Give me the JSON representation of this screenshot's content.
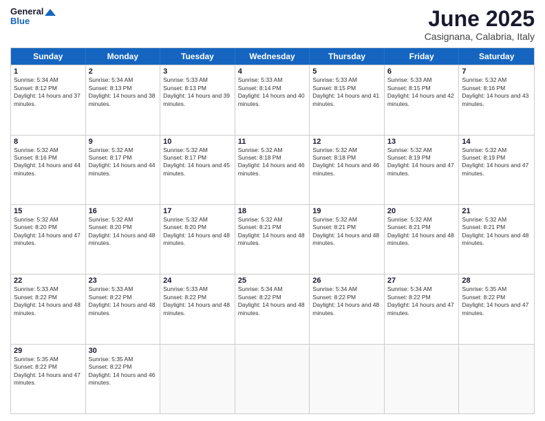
{
  "logo": {
    "line1": "General",
    "line2": "Blue"
  },
  "title": "June 2025",
  "subtitle": "Casignana, Calabria, Italy",
  "header_days": [
    "Sunday",
    "Monday",
    "Tuesday",
    "Wednesday",
    "Thursday",
    "Friday",
    "Saturday"
  ],
  "rows": [
    [
      {
        "day": "",
        "sunrise": "",
        "sunset": "",
        "daylight": ""
      },
      {
        "day": "2",
        "sunrise": "Sunrise: 5:34 AM",
        "sunset": "Sunset: 8:13 PM",
        "daylight": "Daylight: 14 hours and 38 minutes."
      },
      {
        "day": "3",
        "sunrise": "Sunrise: 5:33 AM",
        "sunset": "Sunset: 8:13 PM",
        "daylight": "Daylight: 14 hours and 39 minutes."
      },
      {
        "day": "4",
        "sunrise": "Sunrise: 5:33 AM",
        "sunset": "Sunset: 8:14 PM",
        "daylight": "Daylight: 14 hours and 40 minutes."
      },
      {
        "day": "5",
        "sunrise": "Sunrise: 5:33 AM",
        "sunset": "Sunset: 8:15 PM",
        "daylight": "Daylight: 14 hours and 41 minutes."
      },
      {
        "day": "6",
        "sunrise": "Sunrise: 5:33 AM",
        "sunset": "Sunset: 8:15 PM",
        "daylight": "Daylight: 14 hours and 42 minutes."
      },
      {
        "day": "7",
        "sunrise": "Sunrise: 5:32 AM",
        "sunset": "Sunset: 8:16 PM",
        "daylight": "Daylight: 14 hours and 43 minutes."
      }
    ],
    [
      {
        "day": "8",
        "sunrise": "Sunrise: 5:32 AM",
        "sunset": "Sunset: 8:16 PM",
        "daylight": "Daylight: 14 hours and 44 minutes."
      },
      {
        "day": "9",
        "sunrise": "Sunrise: 5:32 AM",
        "sunset": "Sunset: 8:17 PM",
        "daylight": "Daylight: 14 hours and 44 minutes."
      },
      {
        "day": "10",
        "sunrise": "Sunrise: 5:32 AM",
        "sunset": "Sunset: 8:17 PM",
        "daylight": "Daylight: 14 hours and 45 minutes."
      },
      {
        "day": "11",
        "sunrise": "Sunrise: 5:32 AM",
        "sunset": "Sunset: 8:18 PM",
        "daylight": "Daylight: 14 hours and 46 minutes."
      },
      {
        "day": "12",
        "sunrise": "Sunrise: 5:32 AM",
        "sunset": "Sunset: 8:18 PM",
        "daylight": "Daylight: 14 hours and 46 minutes."
      },
      {
        "day": "13",
        "sunrise": "Sunrise: 5:32 AM",
        "sunset": "Sunset: 8:19 PM",
        "daylight": "Daylight: 14 hours and 47 minutes."
      },
      {
        "day": "14",
        "sunrise": "Sunrise: 5:32 AM",
        "sunset": "Sunset: 8:19 PM",
        "daylight": "Daylight: 14 hours and 47 minutes."
      }
    ],
    [
      {
        "day": "15",
        "sunrise": "Sunrise: 5:32 AM",
        "sunset": "Sunset: 8:20 PM",
        "daylight": "Daylight: 14 hours and 47 minutes."
      },
      {
        "day": "16",
        "sunrise": "Sunrise: 5:32 AM",
        "sunset": "Sunset: 8:20 PM",
        "daylight": "Daylight: 14 hours and 48 minutes."
      },
      {
        "day": "17",
        "sunrise": "Sunrise: 5:32 AM",
        "sunset": "Sunset: 8:20 PM",
        "daylight": "Daylight: 14 hours and 48 minutes."
      },
      {
        "day": "18",
        "sunrise": "Sunrise: 5:32 AM",
        "sunset": "Sunset: 8:21 PM",
        "daylight": "Daylight: 14 hours and 48 minutes."
      },
      {
        "day": "19",
        "sunrise": "Sunrise: 5:32 AM",
        "sunset": "Sunset: 8:21 PM",
        "daylight": "Daylight: 14 hours and 48 minutes."
      },
      {
        "day": "20",
        "sunrise": "Sunrise: 5:32 AM",
        "sunset": "Sunset: 8:21 PM",
        "daylight": "Daylight: 14 hours and 48 minutes."
      },
      {
        "day": "21",
        "sunrise": "Sunrise: 5:32 AM",
        "sunset": "Sunset: 8:21 PM",
        "daylight": "Daylight: 14 hours and 48 minutes."
      }
    ],
    [
      {
        "day": "22",
        "sunrise": "Sunrise: 5:33 AM",
        "sunset": "Sunset: 8:22 PM",
        "daylight": "Daylight: 14 hours and 48 minutes."
      },
      {
        "day": "23",
        "sunrise": "Sunrise: 5:33 AM",
        "sunset": "Sunset: 8:22 PM",
        "daylight": "Daylight: 14 hours and 48 minutes."
      },
      {
        "day": "24",
        "sunrise": "Sunrise: 5:33 AM",
        "sunset": "Sunset: 8:22 PM",
        "daylight": "Daylight: 14 hours and 48 minutes."
      },
      {
        "day": "25",
        "sunrise": "Sunrise: 5:34 AM",
        "sunset": "Sunset: 8:22 PM",
        "daylight": "Daylight: 14 hours and 48 minutes."
      },
      {
        "day": "26",
        "sunrise": "Sunrise: 5:34 AM",
        "sunset": "Sunset: 8:22 PM",
        "daylight": "Daylight: 14 hours and 48 minutes."
      },
      {
        "day": "27",
        "sunrise": "Sunrise: 5:34 AM",
        "sunset": "Sunset: 8:22 PM",
        "daylight": "Daylight: 14 hours and 47 minutes."
      },
      {
        "day": "28",
        "sunrise": "Sunrise: 5:35 AM",
        "sunset": "Sunset: 8:22 PM",
        "daylight": "Daylight: 14 hours and 47 minutes."
      }
    ],
    [
      {
        "day": "29",
        "sunrise": "Sunrise: 5:35 AM",
        "sunset": "Sunset: 8:22 PM",
        "daylight": "Daylight: 14 hours and 47 minutes."
      },
      {
        "day": "30",
        "sunrise": "Sunrise: 5:35 AM",
        "sunset": "Sunset: 8:22 PM",
        "daylight": "Daylight: 14 hours and 46 minutes."
      },
      {
        "day": "",
        "sunrise": "",
        "sunset": "",
        "daylight": ""
      },
      {
        "day": "",
        "sunrise": "",
        "sunset": "",
        "daylight": ""
      },
      {
        "day": "",
        "sunrise": "",
        "sunset": "",
        "daylight": ""
      },
      {
        "day": "",
        "sunrise": "",
        "sunset": "",
        "daylight": ""
      },
      {
        "day": "",
        "sunrise": "",
        "sunset": "",
        "daylight": ""
      }
    ]
  ],
  "row0_day1": {
    "day": "1",
    "sunrise": "Sunrise: 5:34 AM",
    "sunset": "Sunset: 8:12 PM",
    "daylight": "Daylight: 14 hours and 37 minutes."
  }
}
